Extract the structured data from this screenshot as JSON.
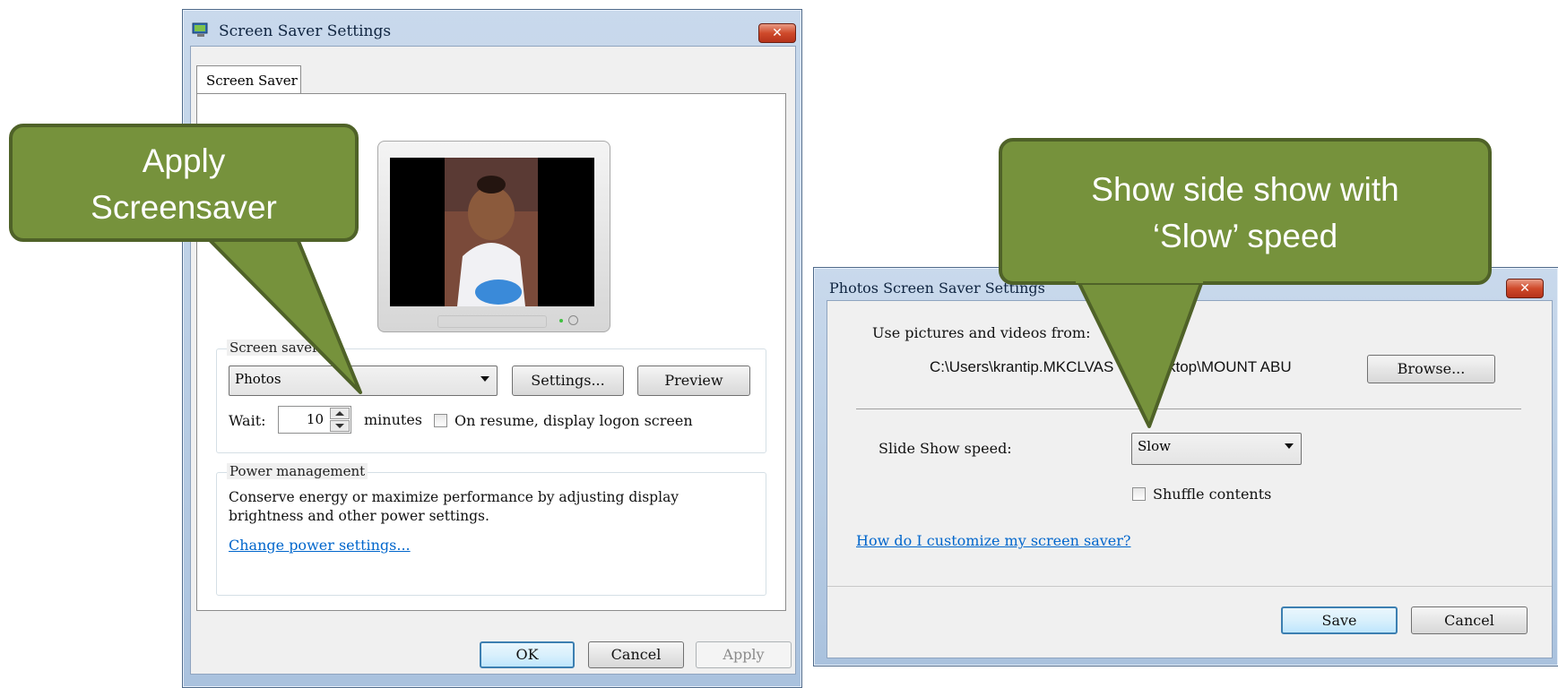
{
  "screensaver_dialog": {
    "title": "Screen Saver Settings",
    "close_glyph": "✕",
    "tab_label": "Screen Saver",
    "group_screensaver_label": "Screen saver",
    "screensaver_value": "Photos",
    "settings_label": "Settings...",
    "preview_label": "Preview",
    "wait_label": "Wait:",
    "wait_value": "10",
    "minutes_label": "minutes",
    "resume_label": "On resume, display logon screen",
    "power_group_label": "Power management",
    "power_text_line1": "Conserve energy or maximize performance by adjusting display",
    "power_text_line2": "brightness and other power settings.",
    "power_link": "Change power settings...",
    "ok_label": "OK",
    "cancel_label": "Cancel",
    "apply_label": "Apply"
  },
  "photos_dialog": {
    "title": "Photos Screen Saver Settings",
    "close_glyph": "✕",
    "use_pictures_label": "Use pictures and videos from:",
    "path_left": "C:\\Users\\krantip.MKCLVAS",
    "path_right": "ktop\\MOUNT ABU",
    "browse_label": "Browse...",
    "slideshow_label": "Slide Show speed:",
    "speed_value": "Slow",
    "shuffle_label": "Shuffle contents",
    "help_link": "How do I customize my screen saver?",
    "save_label": "Save",
    "cancel_label": "Cancel"
  },
  "callouts": {
    "left_line1": "Apply",
    "left_line2": "Screensaver",
    "right_line1": "Show side show with",
    "right_line2": "‘Slow’ speed"
  },
  "colors": {
    "callout_fill": "#76923c",
    "callout_border": "#4f6228",
    "link": "#0066cc"
  }
}
